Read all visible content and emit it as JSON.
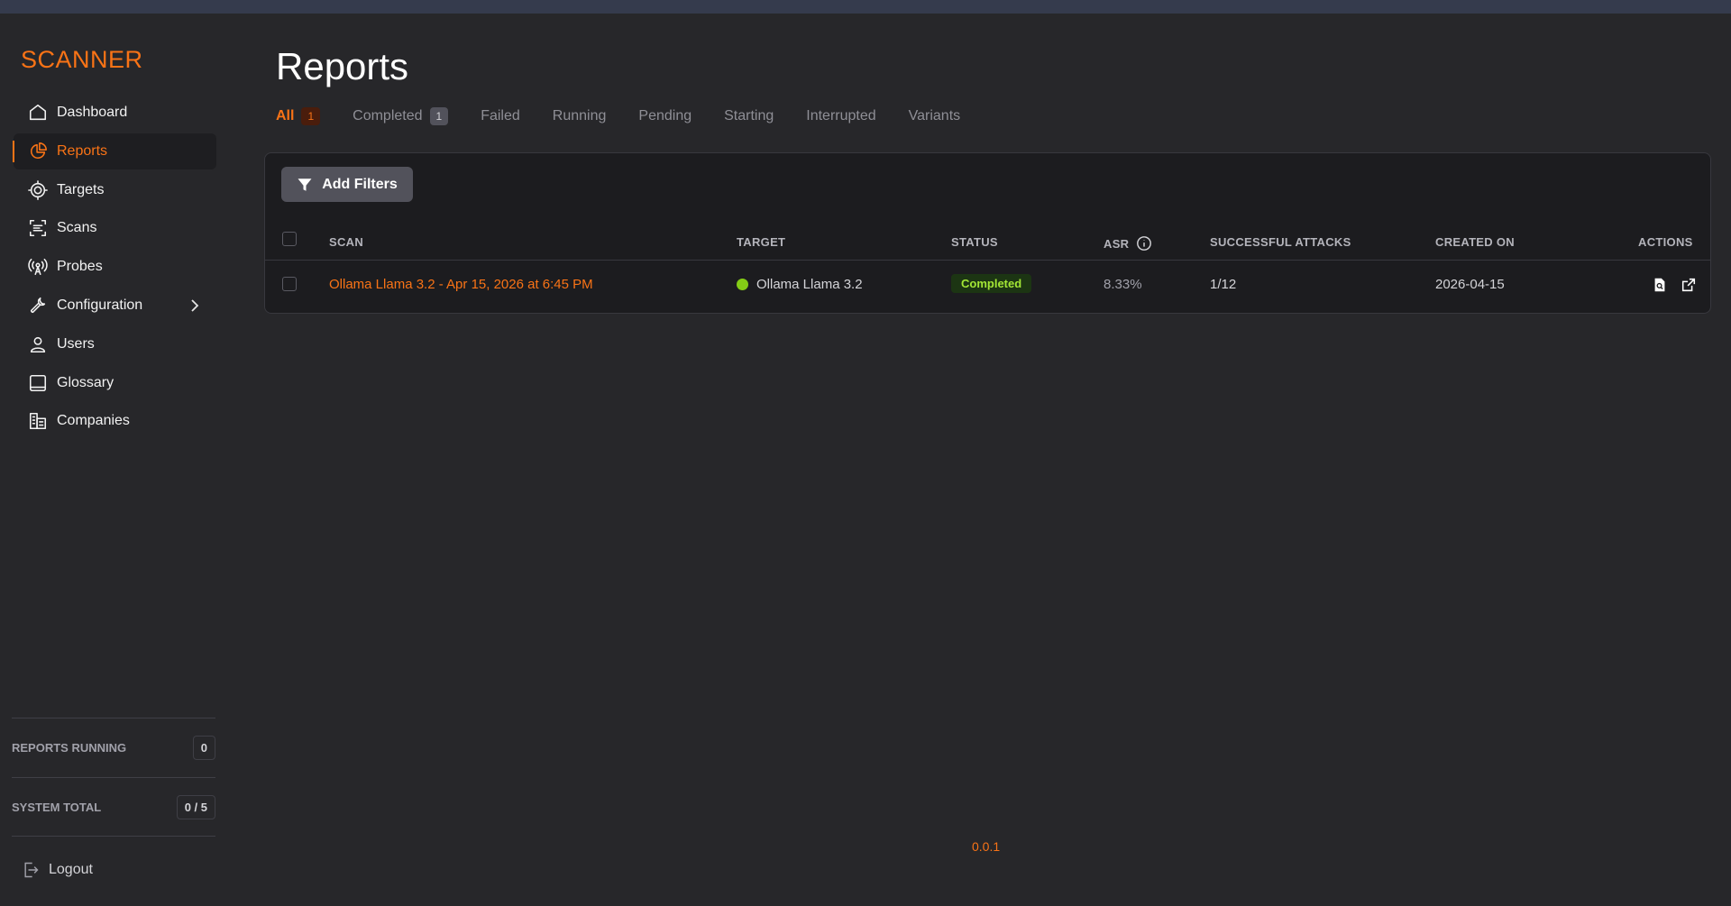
{
  "app": {
    "brand": "SCANNER",
    "version": "0.0.1"
  },
  "sidebar": {
    "items": [
      {
        "label": "Dashboard",
        "icon": "home-icon"
      },
      {
        "label": "Reports",
        "icon": "pie-chart-icon",
        "active": true
      },
      {
        "label": "Targets",
        "icon": "target-icon"
      },
      {
        "label": "Scans",
        "icon": "scan-icon"
      },
      {
        "label": "Probes",
        "icon": "broadcast-icon"
      },
      {
        "label": "Configuration",
        "icon": "wrench-icon",
        "has_submenu": true
      },
      {
        "label": "Users",
        "icon": "user-icon"
      },
      {
        "label": "Glossary",
        "icon": "book-icon"
      },
      {
        "label": "Companies",
        "icon": "building-icon"
      }
    ],
    "stats": {
      "reports_running_label": "REPORTS RUNNING",
      "reports_running_value": "0",
      "system_total_label": "SYSTEM TOTAL",
      "system_total_value": "0 / 5"
    },
    "logout_label": "Logout"
  },
  "page": {
    "title": "Reports",
    "tabs": [
      {
        "label": "All",
        "count": "1",
        "active": true
      },
      {
        "label": "Completed",
        "count": "1"
      },
      {
        "label": "Failed"
      },
      {
        "label": "Running"
      },
      {
        "label": "Pending"
      },
      {
        "label": "Starting"
      },
      {
        "label": "Interrupted"
      },
      {
        "label": "Variants"
      }
    ],
    "add_filters_label": "Add Filters"
  },
  "table": {
    "columns": {
      "scan": "SCAN",
      "target": "TARGET",
      "status": "STATUS",
      "asr": "ASR",
      "successful_attacks": "SUCCESSFUL ATTACKS",
      "created_on": "CREATED ON",
      "actions": "ACTIONS"
    },
    "rows": [
      {
        "scan": "Ollama Llama 3.2 - Apr 15, 2026 at 6:45 PM",
        "target": "Ollama Llama 3.2",
        "target_status_color": "#84cc16",
        "status": "Completed",
        "asr": "8.33%",
        "successful_attacks": "1/12",
        "created_on": "2026-04-15"
      }
    ]
  },
  "colors": {
    "accent": "#f97316",
    "background": "#27272a",
    "panel": "#1c1c1f",
    "success": "#84cc16"
  }
}
